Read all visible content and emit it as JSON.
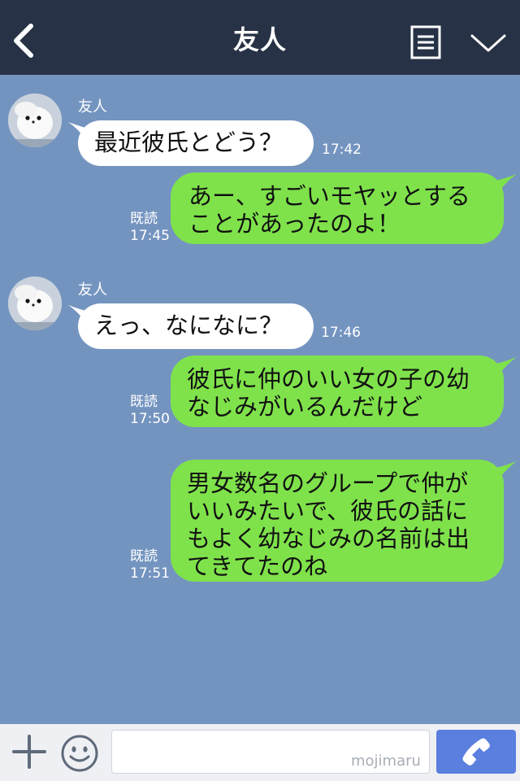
{
  "header": {
    "title": "友人",
    "icons": {
      "back": "chevron-left-icon",
      "menu": "notes-icon",
      "collapse": "chevron-down-icon"
    }
  },
  "messages": [
    {
      "direction": "incoming",
      "sender": "友人",
      "text": "最近彼氏とどう？",
      "time": "17:42"
    },
    {
      "direction": "outgoing",
      "status": "既読",
      "lines": [
        "あー、すごいモヤッとする",
        "ことがあったのよ！"
      ],
      "time": "17:45"
    },
    {
      "direction": "incoming",
      "sender": "友人",
      "text": "えっ、なになに？",
      "time": "17:46"
    },
    {
      "direction": "outgoing",
      "status": "既読",
      "lines": [
        "彼氏に仲のいい女の子の幼",
        "なじみがいるんだけど"
      ],
      "time": "17:50"
    },
    {
      "direction": "outgoing",
      "status": "既読",
      "lines": [
        "男女数名のグループで仲が",
        "いいみたいで、彼氏の話に",
        "もよく幼なじみの名前は出",
        "てきてたのね"
      ],
      "time": "17:51"
    }
  ],
  "footer": {
    "input_value": "",
    "watermark": "mojimaru",
    "icons": {
      "add": "plus-icon",
      "emoji": "smiley-icon",
      "call": "phone-icon"
    }
  },
  "colors": {
    "header": "#273246",
    "background": "#7494c0",
    "outgoing": "#7fe24b",
    "incoming": "#ffffff",
    "call_button": "#5b7fdf"
  }
}
